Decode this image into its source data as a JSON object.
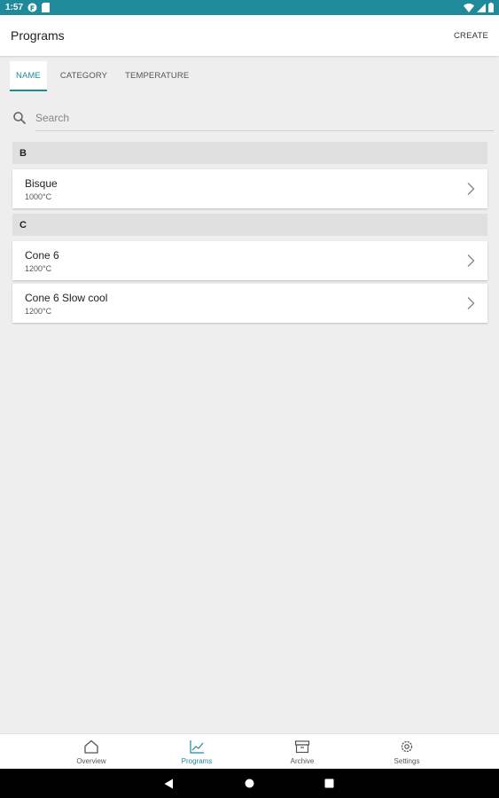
{
  "status_bar": {
    "time": "1:57",
    "background": "#1f8a99"
  },
  "app_bar": {
    "title": "Programs",
    "create_label": "CREATE"
  },
  "tabs": [
    {
      "label": "NAME",
      "active": true
    },
    {
      "label": "CATEGORY",
      "active": false
    },
    {
      "label": "TEMPERATURE",
      "active": false
    }
  ],
  "search": {
    "placeholder": "Search",
    "value": ""
  },
  "sections": [
    {
      "header": "B",
      "items": [
        {
          "name": "Bisque",
          "temperature": "1000°C"
        }
      ]
    },
    {
      "header": "C",
      "items": [
        {
          "name": "Cone 6",
          "temperature": "1200°C"
        },
        {
          "name": "Cone 6 Slow cool",
          "temperature": "1200°C"
        }
      ]
    }
  ],
  "bottom_nav": [
    {
      "label": "Overview",
      "icon": "home-icon",
      "active": false
    },
    {
      "label": "Programs",
      "icon": "chart-line-icon",
      "active": true
    },
    {
      "label": "Archive",
      "icon": "archive-icon",
      "active": false
    },
    {
      "label": "Settings",
      "icon": "gear-icon",
      "active": false
    }
  ],
  "colors": {
    "accent": "#1f8a99",
    "background": "#eeeeee",
    "section_header": "#e0e0e0"
  }
}
